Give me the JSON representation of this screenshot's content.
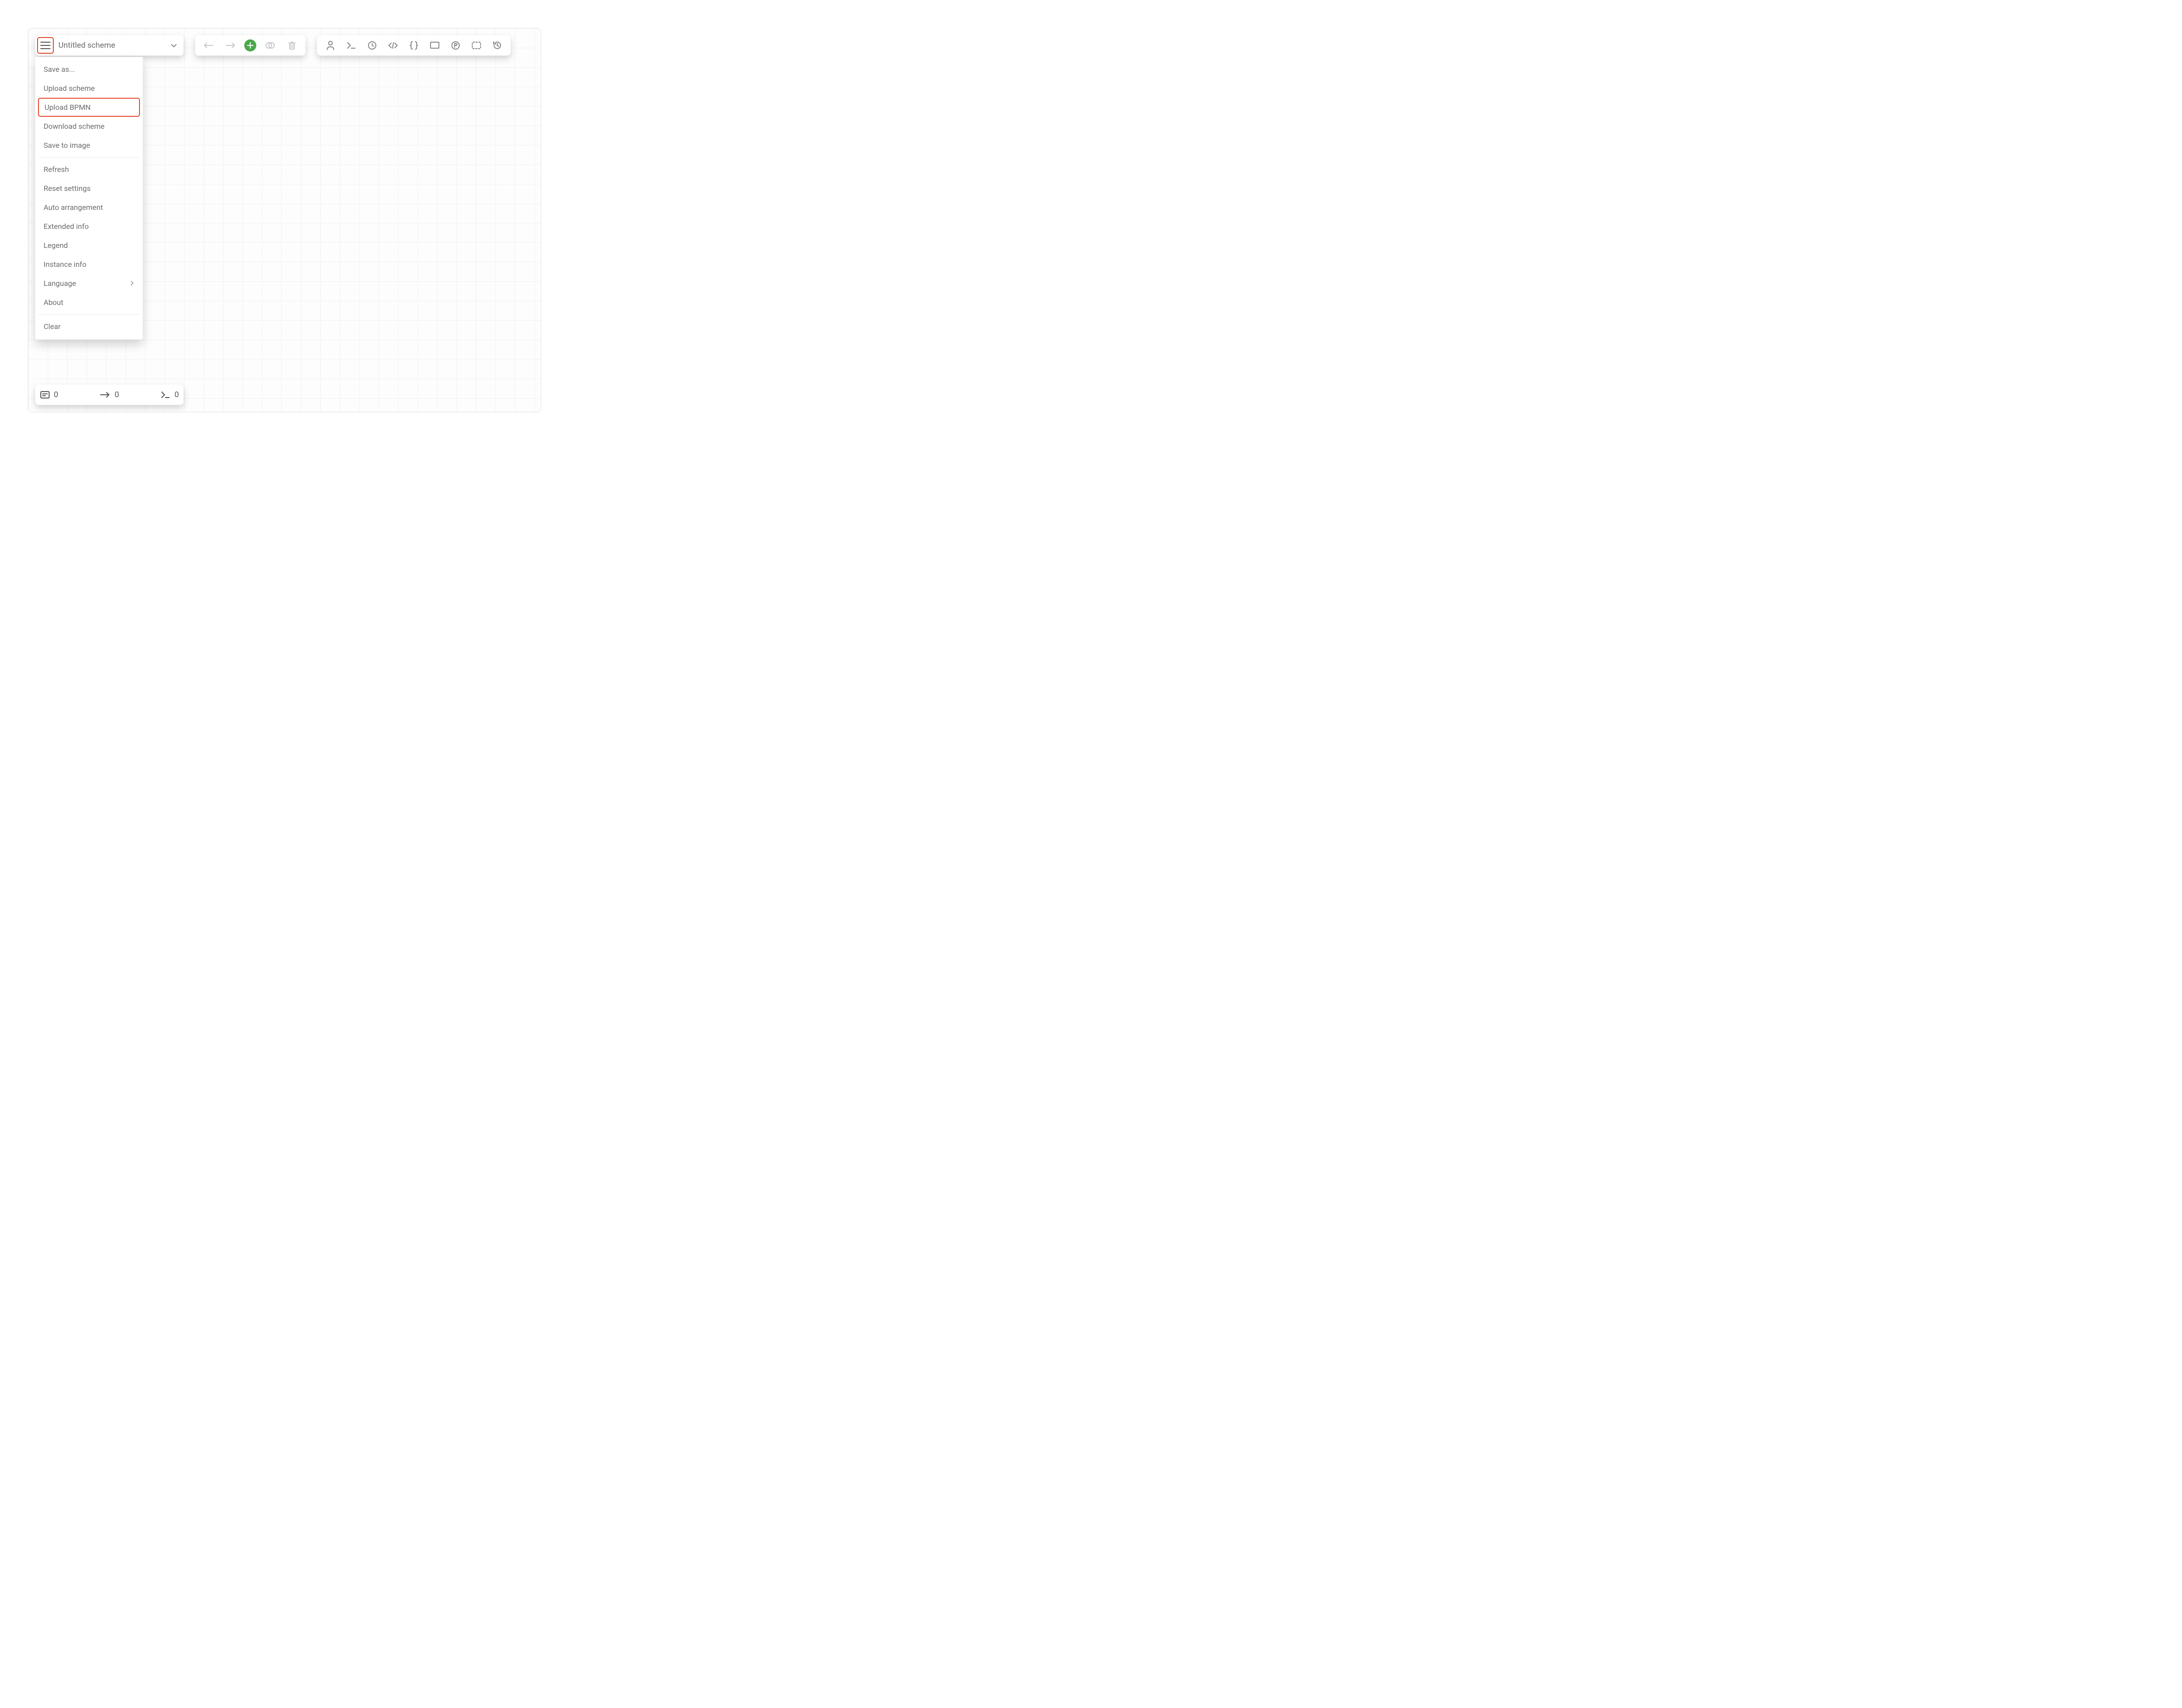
{
  "header": {
    "scheme_name": "Untitled scheme"
  },
  "menu": {
    "save_as": "Save as...",
    "upload_scheme": "Upload scheme",
    "upload_bpmn": "Upload BPMN",
    "download_scheme": "Download scheme",
    "save_to_image": "Save to image",
    "refresh": "Refresh",
    "reset_settings": "Reset settings",
    "auto_arrangement": "Auto arrangement",
    "extended_info": "Extended info",
    "legend": "Legend",
    "instance_info": "Instance info",
    "language": "Language",
    "about": "About",
    "clear": "Clear"
  },
  "status": {
    "activities": "0",
    "transitions": "0",
    "commands": "0"
  }
}
